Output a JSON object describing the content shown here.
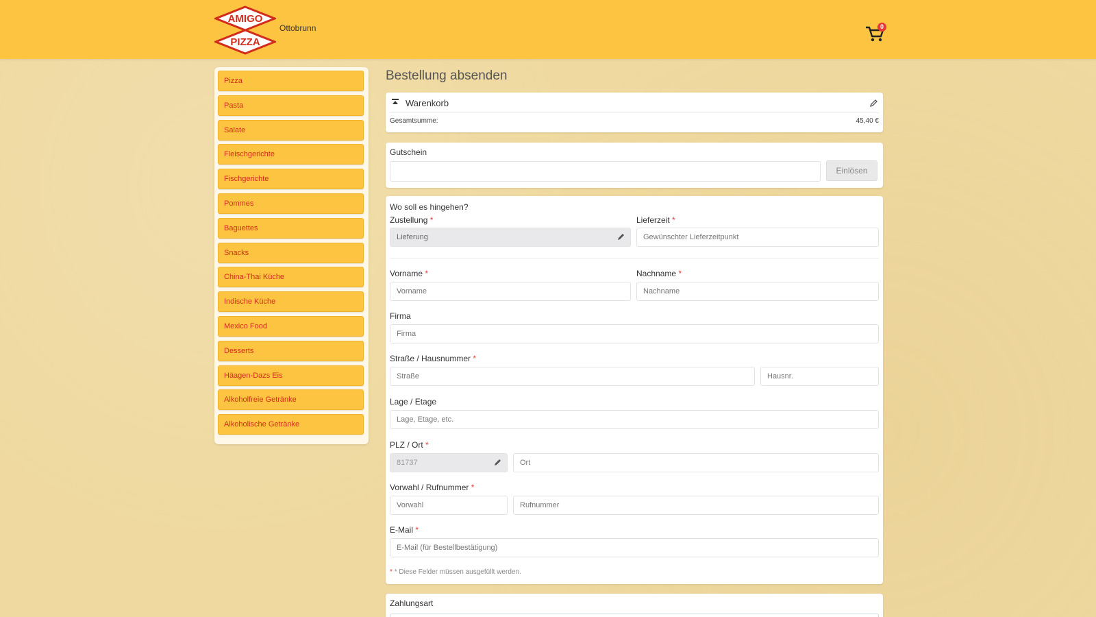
{
  "header": {
    "logo_text_top": "AMIGO",
    "logo_text_bottom": "PIZZA",
    "location": "Ottobrunn",
    "cart_count": "0",
    "colors": {
      "bar": "#fcc441",
      "logo_red": "#d22d1c",
      "badge": "#e53935"
    }
  },
  "sidebar": {
    "items": [
      {
        "label": "Pizza"
      },
      {
        "label": "Pasta"
      },
      {
        "label": "Salate"
      },
      {
        "label": "Fleischgerichte"
      },
      {
        "label": "Fischgerichte"
      },
      {
        "label": "Pommes"
      },
      {
        "label": "Baguettes"
      },
      {
        "label": "Snacks"
      },
      {
        "label": "China-Thai Küche"
      },
      {
        "label": "Indische Küche"
      },
      {
        "label": "Mexico Food"
      },
      {
        "label": "Desserts"
      },
      {
        "label": "Häagen-Dazs Eis"
      },
      {
        "label": "Alkoholfreie Getränke"
      },
      {
        "label": "Alkoholische Getränke"
      }
    ]
  },
  "main": {
    "title": "Bestellung absenden",
    "cart": {
      "heading": "Warenkorb",
      "total_label": "Gesamtsumme:",
      "total_value": "45,40 €"
    },
    "coupon": {
      "label": "Gutschein",
      "input_placeholder": "",
      "button_label": "Einlösen"
    },
    "form": {
      "question": "Wo soll es hingehen?",
      "zustellung": {
        "label": "Zustellung",
        "value": "Lieferung"
      },
      "lieferzeit": {
        "label": "Lieferzeit",
        "placeholder": "Gewünschter Lieferzeitpunkt"
      },
      "vorname": {
        "label": "Vorname",
        "placeholder": "Vorname"
      },
      "nachname": {
        "label": "Nachname",
        "placeholder": "Nachname"
      },
      "firma": {
        "label": "Firma",
        "placeholder": "Firma"
      },
      "strasse": {
        "label": "Straße / Hausnummer",
        "placeholder": "Straße",
        "hausnr_placeholder": "Hausnr."
      },
      "lage": {
        "label": "Lage / Etage",
        "placeholder": "Lage, Etage, etc."
      },
      "plz": {
        "label": "PLZ / Ort",
        "value": "81737",
        "ort_placeholder": "Ort"
      },
      "telefon": {
        "label": "Vorwahl / Rufnummer",
        "vorwahl_placeholder": "Vorwahl",
        "rufnummer_placeholder": "Rufnummer"
      },
      "email": {
        "label": "E-Mail",
        "placeholder": "E-Mail (für Bestellbestätigung)"
      },
      "required_note": "* Diese Felder müssen ausgefüllt werden."
    },
    "payment": {
      "label": "Zahlungsart"
    }
  }
}
